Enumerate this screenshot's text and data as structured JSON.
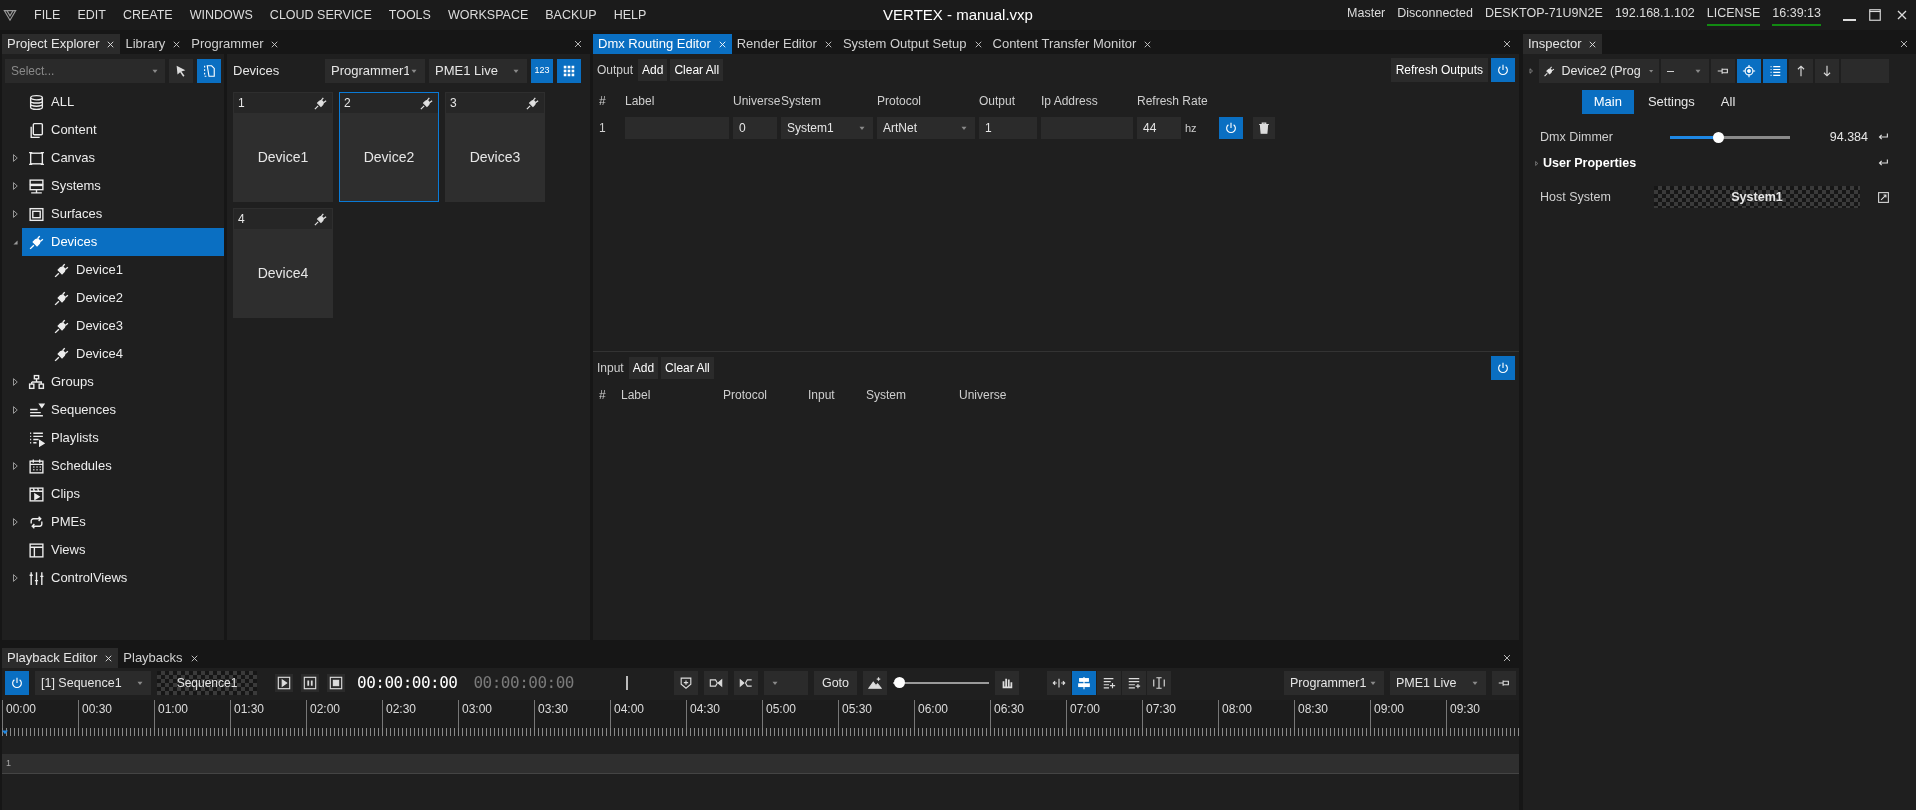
{
  "menu_bar": {
    "items": [
      "FILE",
      "EDIT",
      "CREATE",
      "WINDOWS",
      "CLOUD SERVICE",
      "TOOLS",
      "WORKSPACE",
      "BACKUP",
      "HELP"
    ]
  },
  "window": {
    "title": "VERTEX - manual.vxp"
  },
  "status_bar": [
    {
      "text": "Master",
      "underlined": false
    },
    {
      "text": "Disconnected",
      "underlined": false
    },
    {
      "text": "DESKTOP-71U9N2E",
      "underlined": false
    },
    {
      "text": "192.168.1.102",
      "underlined": false
    },
    {
      "text": "LICENSE",
      "underlined": true
    },
    {
      "text": "16:39:13",
      "underlined": true
    }
  ],
  "left_dock": {
    "focused": false,
    "tabs": [
      {
        "label": "Project Explorer",
        "selected": true
      },
      {
        "label": "Library",
        "selected": false
      },
      {
        "label": "Programmer",
        "selected": false
      }
    ]
  },
  "project_explorer": {
    "search": {
      "placeholder": "Select..."
    },
    "tree": [
      {
        "label": "ALL",
        "kind": "database",
        "selected": false
      },
      {
        "label": "Content",
        "kind": "documents",
        "selected": false
      },
      {
        "label": "Canvas",
        "kind": "frame",
        "expanded": false,
        "selected": false
      },
      {
        "label": "Systems",
        "kind": "server",
        "expanded": false,
        "selected": false
      },
      {
        "label": "Surfaces",
        "kind": "surface",
        "expanded": false,
        "selected": false
      },
      {
        "label": "Devices",
        "kind": "plug",
        "expanded": true,
        "selected": true,
        "children": [
          {
            "label": "Device1",
            "kind": "plug",
            "selected": false
          },
          {
            "label": "Device2",
            "kind": "plug",
            "selected": false
          },
          {
            "label": "Device3",
            "kind": "plug",
            "selected": false
          },
          {
            "label": "Device4",
            "kind": "plug",
            "selected": false
          }
        ]
      },
      {
        "label": "Groups",
        "kind": "hierarchy",
        "expanded": false,
        "selected": false
      },
      {
        "label": "Sequences",
        "kind": "sequence",
        "expanded": false,
        "selected": false
      },
      {
        "label": "Playlists",
        "kind": "playlist",
        "selected": false
      },
      {
        "label": "Schedules",
        "kind": "calendar",
        "expanded": false,
        "selected": false
      },
      {
        "label": "Clips",
        "kind": "clip",
        "selected": false
      },
      {
        "label": "PMEs",
        "kind": "cycle",
        "expanded": false,
        "selected": false
      },
      {
        "label": "Views",
        "kind": "layout",
        "selected": false
      },
      {
        "label": "ControlViews",
        "kind": "sliders",
        "expanded": false,
        "selected": false
      }
    ]
  },
  "devices_panel": {
    "title": "Devices",
    "programmer": "Programmer1",
    "pme": "PME1 Live",
    "numbers_button": {
      "label": "123",
      "on": true
    },
    "grid_button": {
      "on": true
    },
    "tiles": [
      {
        "number": "1",
        "name": "Device1",
        "selected": false
      },
      {
        "number": "2",
        "name": "Device2",
        "selected": true
      },
      {
        "number": "3",
        "name": "Device3",
        "selected": false
      },
      {
        "number": "4",
        "name": "Device4",
        "selected": false
      }
    ]
  },
  "center_dock": {
    "focused": true,
    "tabs": [
      {
        "label": "Dmx Routing Editor",
        "selected": true
      },
      {
        "label": "Render Editor",
        "selected": false
      },
      {
        "label": "System Output Setup",
        "selected": false
      },
      {
        "label": "Content Transfer Monitor",
        "selected": false
      }
    ]
  },
  "dmx_output": {
    "label": "Output",
    "buttons": [
      "Add",
      "Clear All"
    ],
    "refresh_button": "Refresh Outputs",
    "enabled": true,
    "columns": [
      "#",
      "Label",
      "Universe",
      "System",
      "Protocol",
      "Output",
      "Ip Address",
      "Refresh Rate"
    ],
    "rows": [
      {
        "index": "1",
        "universe": "0",
        "system": "System1",
        "protocol": "ArtNet",
        "output": "1",
        "refresh_rate": "44",
        "unit": "hz",
        "enabled": true
      }
    ]
  },
  "dmx_input": {
    "label": "Input",
    "buttons": [
      "Add",
      "Clear All"
    ],
    "enabled": true,
    "columns": [
      "#",
      "Label",
      "Protocol",
      "Input",
      "System",
      "Universe"
    ]
  },
  "inspector": {
    "tab": {
      "label": "Inspector",
      "selected": true
    },
    "object": "Device2 (Prog",
    "mode": "–",
    "target_on": true,
    "list_on": true,
    "tabs": [
      {
        "label": "Main",
        "selected": true
      },
      {
        "label": "Settings",
        "selected": false
      },
      {
        "label": "All",
        "selected": false
      }
    ],
    "properties": [
      {
        "kind": "slider",
        "label": "Dmx Dimmer",
        "level": 0.4,
        "value": "94.384"
      },
      {
        "kind": "section",
        "label": "User Properties"
      },
      {
        "kind": "field",
        "label": "Host System",
        "value": "System1"
      }
    ]
  },
  "playback": {
    "tabs": [
      {
        "label": "Playback Editor",
        "selected": true
      },
      {
        "label": "Playbacks",
        "selected": false
      }
    ],
    "enabled": true,
    "sequence": "[1] Sequence1",
    "sequence_name": "Sequence1",
    "timecode": "00:00:00:00",
    "timecode_end": "00:00:00:00",
    "goto": "Goto",
    "zoom": {
      "level": 0.02
    },
    "align_on": true,
    "programmer": "Programmer1",
    "pme": "PME1 Live",
    "ruler": [
      "00:00",
      "00:30",
      "01:00",
      "01:30",
      "02:00",
      "02:30",
      "03:00",
      "03:30",
      "04:00",
      "04:30",
      "05:00",
      "05:30",
      "06:00",
      "06:30",
      "07:00",
      "07:30",
      "08:00",
      "08:30",
      "09:00",
      "09:30"
    ],
    "tracks": [
      {
        "label": "1"
      }
    ]
  }
}
